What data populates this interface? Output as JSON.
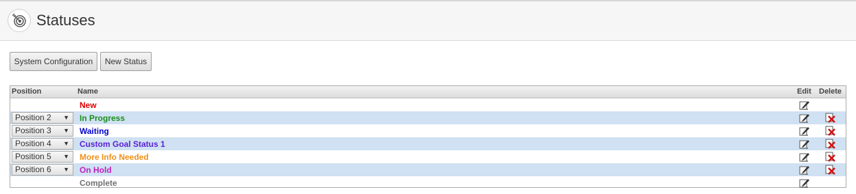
{
  "header": {
    "title": "Statuses",
    "logo_icon": "target-icon"
  },
  "toolbar": {
    "system_config_label": "System Configuration",
    "new_status_label": "New Status"
  },
  "grid": {
    "columns": {
      "position": "Position",
      "name": "Name",
      "edit": "Edit",
      "delete": "Delete"
    },
    "rows": [
      {
        "position": "",
        "name": "New",
        "color": "#e00000",
        "deletable": false
      },
      {
        "position": "Position 2",
        "name": "In Progress",
        "color": "#1a8f1a",
        "deletable": true
      },
      {
        "position": "Position 3",
        "name": "Waiting",
        "color": "#0000cc",
        "deletable": true
      },
      {
        "position": "Position 4",
        "name": "Custom Goal Status 1",
        "color": "#5a1ed8",
        "deletable": true
      },
      {
        "position": "Position 5",
        "name": "More Info Needed",
        "color": "#f0901a",
        "deletable": true
      },
      {
        "position": "Position 6",
        "name": "On Hold",
        "color": "#c020c0",
        "deletable": true
      },
      {
        "position": "",
        "name": "Complete",
        "color": "#707070",
        "deletable": false
      }
    ]
  }
}
